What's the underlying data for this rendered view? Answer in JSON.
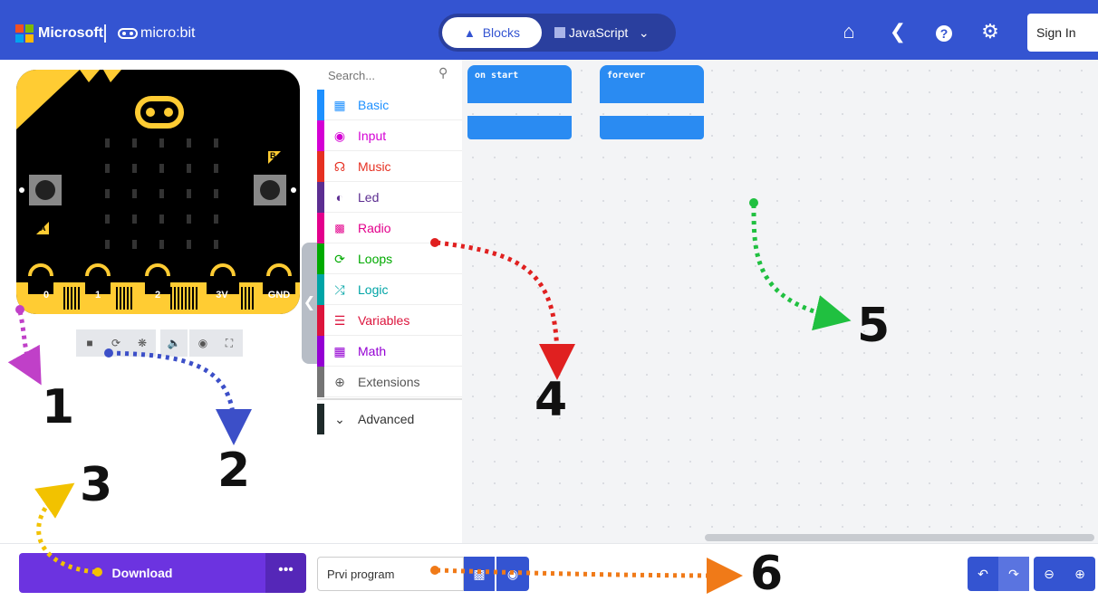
{
  "header": {
    "brand_microsoft": "Microsoft",
    "brand_microbit": "micro:bit",
    "tab_blocks": "Blocks",
    "tab_javascript": "JavaScript",
    "signin": "Sign In",
    "icons": [
      "home-icon",
      "share-icon",
      "help-icon",
      "settings-icon"
    ]
  },
  "simulator": {
    "pins": [
      "0",
      "1",
      "2",
      "3V",
      "GND"
    ],
    "button_a": "A",
    "button_b": "B",
    "toolbar_icons": [
      "stop-icon",
      "restart-icon",
      "debug-icon",
      "mute-icon",
      "screenshot-icon",
      "fullscreen-icon"
    ]
  },
  "toolbox": {
    "search_placeholder": "Search...",
    "categories": [
      {
        "label": "Basic",
        "color": "#1e90ff"
      },
      {
        "label": "Input",
        "color": "#d400d4"
      },
      {
        "label": "Music",
        "color": "#e63022"
      },
      {
        "label": "Led",
        "color": "#5c2d91"
      },
      {
        "label": "Radio",
        "color": "#e3008c"
      },
      {
        "label": "Loops",
        "color": "#00aa00"
      },
      {
        "label": "Logic",
        "color": "#00a4a6"
      },
      {
        "label": "Variables",
        "color": "#dc143c"
      },
      {
        "label": "Math",
        "color": "#9400d3"
      },
      {
        "label": "Extensions",
        "color": "#757575"
      }
    ],
    "advanced": "Advanced"
  },
  "workspace": {
    "block_on_start": "on start",
    "block_forever": "forever"
  },
  "bottom": {
    "download": "Download",
    "more": "•••",
    "project_name": "Prvi program"
  },
  "annotations": [
    "1",
    "2",
    "3",
    "4",
    "5",
    "6"
  ],
  "colors": {
    "header": "#3454d1",
    "download": "#6c33e0",
    "block": "#2a8bf2"
  }
}
